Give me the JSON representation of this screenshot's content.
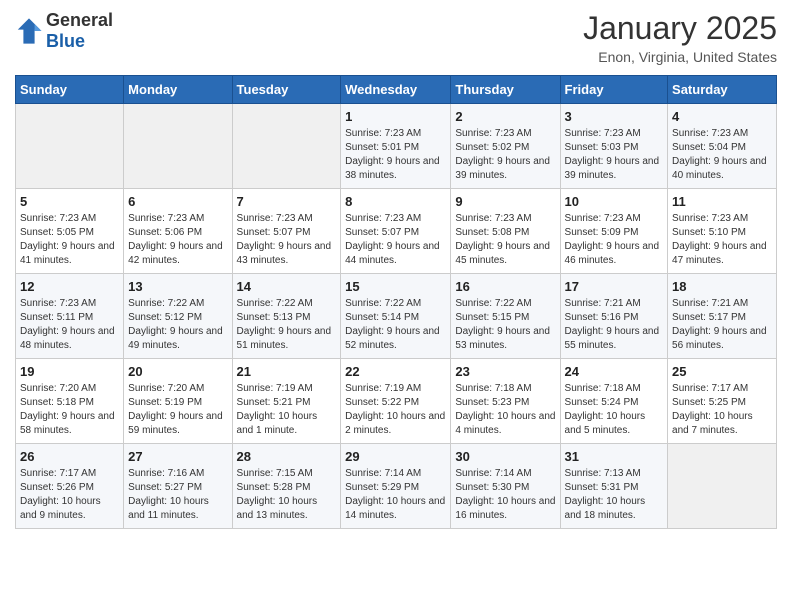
{
  "header": {
    "logo_general": "General",
    "logo_blue": "Blue",
    "month_title": "January 2025",
    "location": "Enon, Virginia, United States"
  },
  "days_of_week": [
    "Sunday",
    "Monday",
    "Tuesday",
    "Wednesday",
    "Thursday",
    "Friday",
    "Saturday"
  ],
  "weeks": [
    [
      {
        "day": "",
        "info": ""
      },
      {
        "day": "",
        "info": ""
      },
      {
        "day": "",
        "info": ""
      },
      {
        "day": "1",
        "info": "Sunrise: 7:23 AM\nSunset: 5:01 PM\nDaylight: 9 hours and 38 minutes."
      },
      {
        "day": "2",
        "info": "Sunrise: 7:23 AM\nSunset: 5:02 PM\nDaylight: 9 hours and 39 minutes."
      },
      {
        "day": "3",
        "info": "Sunrise: 7:23 AM\nSunset: 5:03 PM\nDaylight: 9 hours and 39 minutes."
      },
      {
        "day": "4",
        "info": "Sunrise: 7:23 AM\nSunset: 5:04 PM\nDaylight: 9 hours and 40 minutes."
      }
    ],
    [
      {
        "day": "5",
        "info": "Sunrise: 7:23 AM\nSunset: 5:05 PM\nDaylight: 9 hours and 41 minutes."
      },
      {
        "day": "6",
        "info": "Sunrise: 7:23 AM\nSunset: 5:06 PM\nDaylight: 9 hours and 42 minutes."
      },
      {
        "day": "7",
        "info": "Sunrise: 7:23 AM\nSunset: 5:07 PM\nDaylight: 9 hours and 43 minutes."
      },
      {
        "day": "8",
        "info": "Sunrise: 7:23 AM\nSunset: 5:07 PM\nDaylight: 9 hours and 44 minutes."
      },
      {
        "day": "9",
        "info": "Sunrise: 7:23 AM\nSunset: 5:08 PM\nDaylight: 9 hours and 45 minutes."
      },
      {
        "day": "10",
        "info": "Sunrise: 7:23 AM\nSunset: 5:09 PM\nDaylight: 9 hours and 46 minutes."
      },
      {
        "day": "11",
        "info": "Sunrise: 7:23 AM\nSunset: 5:10 PM\nDaylight: 9 hours and 47 minutes."
      }
    ],
    [
      {
        "day": "12",
        "info": "Sunrise: 7:23 AM\nSunset: 5:11 PM\nDaylight: 9 hours and 48 minutes."
      },
      {
        "day": "13",
        "info": "Sunrise: 7:22 AM\nSunset: 5:12 PM\nDaylight: 9 hours and 49 minutes."
      },
      {
        "day": "14",
        "info": "Sunrise: 7:22 AM\nSunset: 5:13 PM\nDaylight: 9 hours and 51 minutes."
      },
      {
        "day": "15",
        "info": "Sunrise: 7:22 AM\nSunset: 5:14 PM\nDaylight: 9 hours and 52 minutes."
      },
      {
        "day": "16",
        "info": "Sunrise: 7:22 AM\nSunset: 5:15 PM\nDaylight: 9 hours and 53 minutes."
      },
      {
        "day": "17",
        "info": "Sunrise: 7:21 AM\nSunset: 5:16 PM\nDaylight: 9 hours and 55 minutes."
      },
      {
        "day": "18",
        "info": "Sunrise: 7:21 AM\nSunset: 5:17 PM\nDaylight: 9 hours and 56 minutes."
      }
    ],
    [
      {
        "day": "19",
        "info": "Sunrise: 7:20 AM\nSunset: 5:18 PM\nDaylight: 9 hours and 58 minutes."
      },
      {
        "day": "20",
        "info": "Sunrise: 7:20 AM\nSunset: 5:19 PM\nDaylight: 9 hours and 59 minutes."
      },
      {
        "day": "21",
        "info": "Sunrise: 7:19 AM\nSunset: 5:21 PM\nDaylight: 10 hours and 1 minute."
      },
      {
        "day": "22",
        "info": "Sunrise: 7:19 AM\nSunset: 5:22 PM\nDaylight: 10 hours and 2 minutes."
      },
      {
        "day": "23",
        "info": "Sunrise: 7:18 AM\nSunset: 5:23 PM\nDaylight: 10 hours and 4 minutes."
      },
      {
        "day": "24",
        "info": "Sunrise: 7:18 AM\nSunset: 5:24 PM\nDaylight: 10 hours and 5 minutes."
      },
      {
        "day": "25",
        "info": "Sunrise: 7:17 AM\nSunset: 5:25 PM\nDaylight: 10 hours and 7 minutes."
      }
    ],
    [
      {
        "day": "26",
        "info": "Sunrise: 7:17 AM\nSunset: 5:26 PM\nDaylight: 10 hours and 9 minutes."
      },
      {
        "day": "27",
        "info": "Sunrise: 7:16 AM\nSunset: 5:27 PM\nDaylight: 10 hours and 11 minutes."
      },
      {
        "day": "28",
        "info": "Sunrise: 7:15 AM\nSunset: 5:28 PM\nDaylight: 10 hours and 13 minutes."
      },
      {
        "day": "29",
        "info": "Sunrise: 7:14 AM\nSunset: 5:29 PM\nDaylight: 10 hours and 14 minutes."
      },
      {
        "day": "30",
        "info": "Sunrise: 7:14 AM\nSunset: 5:30 PM\nDaylight: 10 hours and 16 minutes."
      },
      {
        "day": "31",
        "info": "Sunrise: 7:13 AM\nSunset: 5:31 PM\nDaylight: 10 hours and 18 minutes."
      },
      {
        "day": "",
        "info": ""
      }
    ]
  ]
}
